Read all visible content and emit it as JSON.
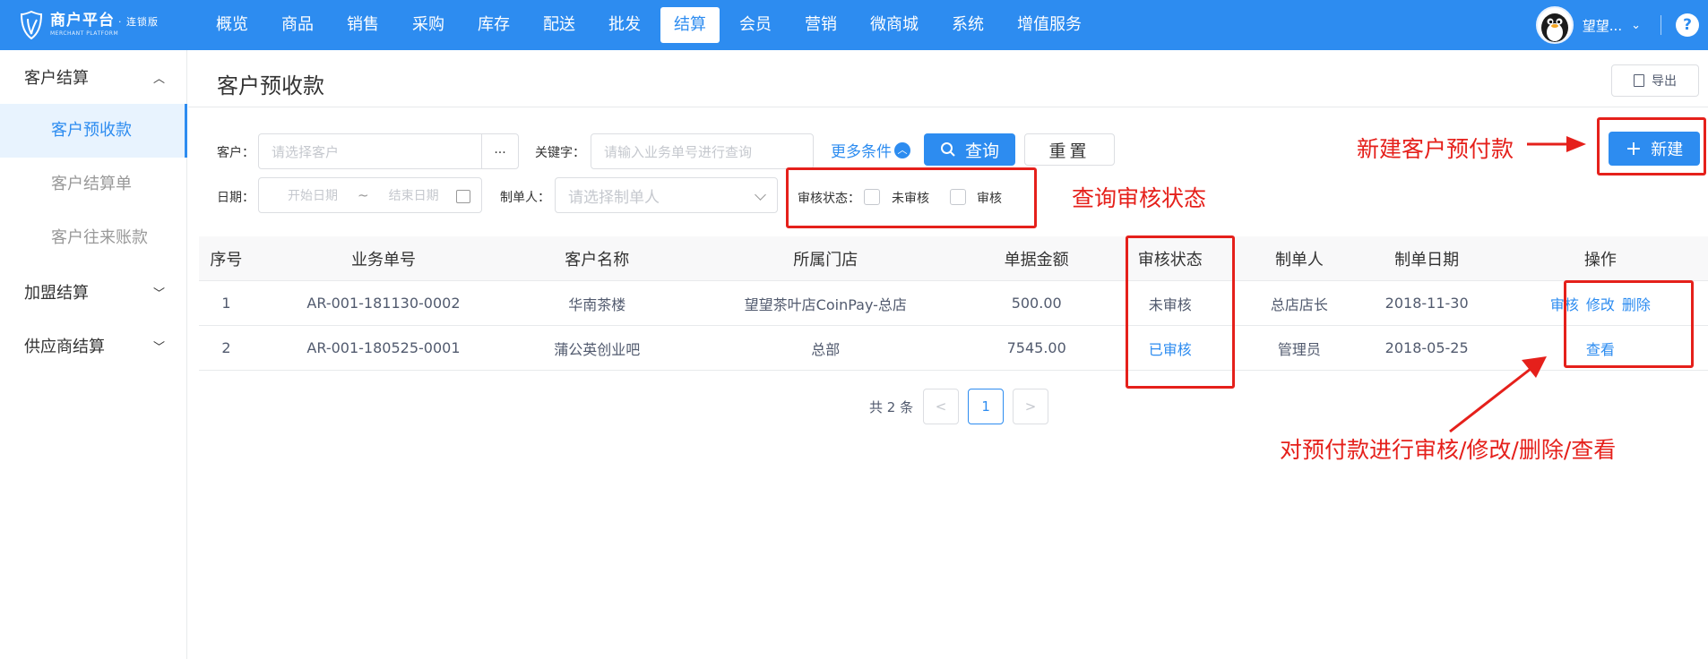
{
  "brand": {
    "name": "商户平台",
    "edition": "· 连锁版",
    "subtitle": "MERCHANT PLATFORM"
  },
  "nav": {
    "items": [
      "概览",
      "商品",
      "销售",
      "采购",
      "库存",
      "配送",
      "批发",
      "结算",
      "会员",
      "营销",
      "微商城",
      "系统",
      "增值服务"
    ],
    "active_index": 7
  },
  "user": {
    "name": "望望...",
    "avatar_icon": "penguin-avatar",
    "help": "?"
  },
  "sidebar": {
    "groups": [
      {
        "label": "客户结算",
        "expanded": true,
        "items": [
          {
            "label": "客户预收款",
            "active": true
          },
          {
            "label": "客户结算单",
            "active": false
          },
          {
            "label": "客户往来账款",
            "active": false
          }
        ]
      },
      {
        "label": "加盟结算",
        "expanded": false
      },
      {
        "label": "供应商结算",
        "expanded": false
      }
    ]
  },
  "page": {
    "title": "客户预收款",
    "export_label": "导出",
    "new_button_label": "新建"
  },
  "filters": {
    "customer_label": "客户：",
    "customer_placeholder": "请选择客户",
    "ellipsis_label": "...",
    "keyword_label": "关键字：",
    "keyword_placeholder": "请输入业务单号进行查询",
    "more_conditions_label": "更多条件",
    "query_label": "查询",
    "reset_label": "重置",
    "date_label": "日期：",
    "start_date_placeholder": "开始日期",
    "date_separator": "~",
    "end_date_placeholder": "结束日期",
    "creator_label": "制单人：",
    "creator_placeholder": "请选择制单人",
    "audit_status_label": "审核状态：",
    "audit_options": [
      {
        "label": "未审核",
        "checked": false
      },
      {
        "label": "审核",
        "checked": false
      }
    ]
  },
  "table": {
    "columns": [
      "序号",
      "业务单号",
      "客户名称",
      "所属门店",
      "单据金额",
      "审核状态",
      "制单人",
      "制单日期",
      "操作"
    ],
    "rows": [
      {
        "index": "1",
        "order_no": "AR-001-181130-0002",
        "customer": "华南茶楼",
        "store": "望望茶叶店CoinPay-总店",
        "amount": "500.00",
        "status": "未审核",
        "creator": "总店店长",
        "date": "2018-11-30",
        "actions": [
          "审核",
          "修改",
          "删除"
        ]
      },
      {
        "index": "2",
        "order_no": "AR-001-180525-0001",
        "customer": "蒲公英创业吧",
        "store": "总部",
        "amount": "7545.00",
        "status": "已审核",
        "creator": "管理员",
        "date": "2018-05-25",
        "actions": [
          "查看"
        ]
      }
    ]
  },
  "pagination": {
    "total_text": "共 2 条",
    "prev": "<",
    "current": "1",
    "next": ">"
  },
  "annotations": {
    "new_prepay": "新建客户预付款",
    "query_status": "查询审核状态",
    "row_actions": "对预付款进行审核/修改/删除/查看",
    "color": "#e5201b"
  },
  "colors": {
    "primary": "#2d8cf0",
    "annotation": "#e5201b"
  }
}
